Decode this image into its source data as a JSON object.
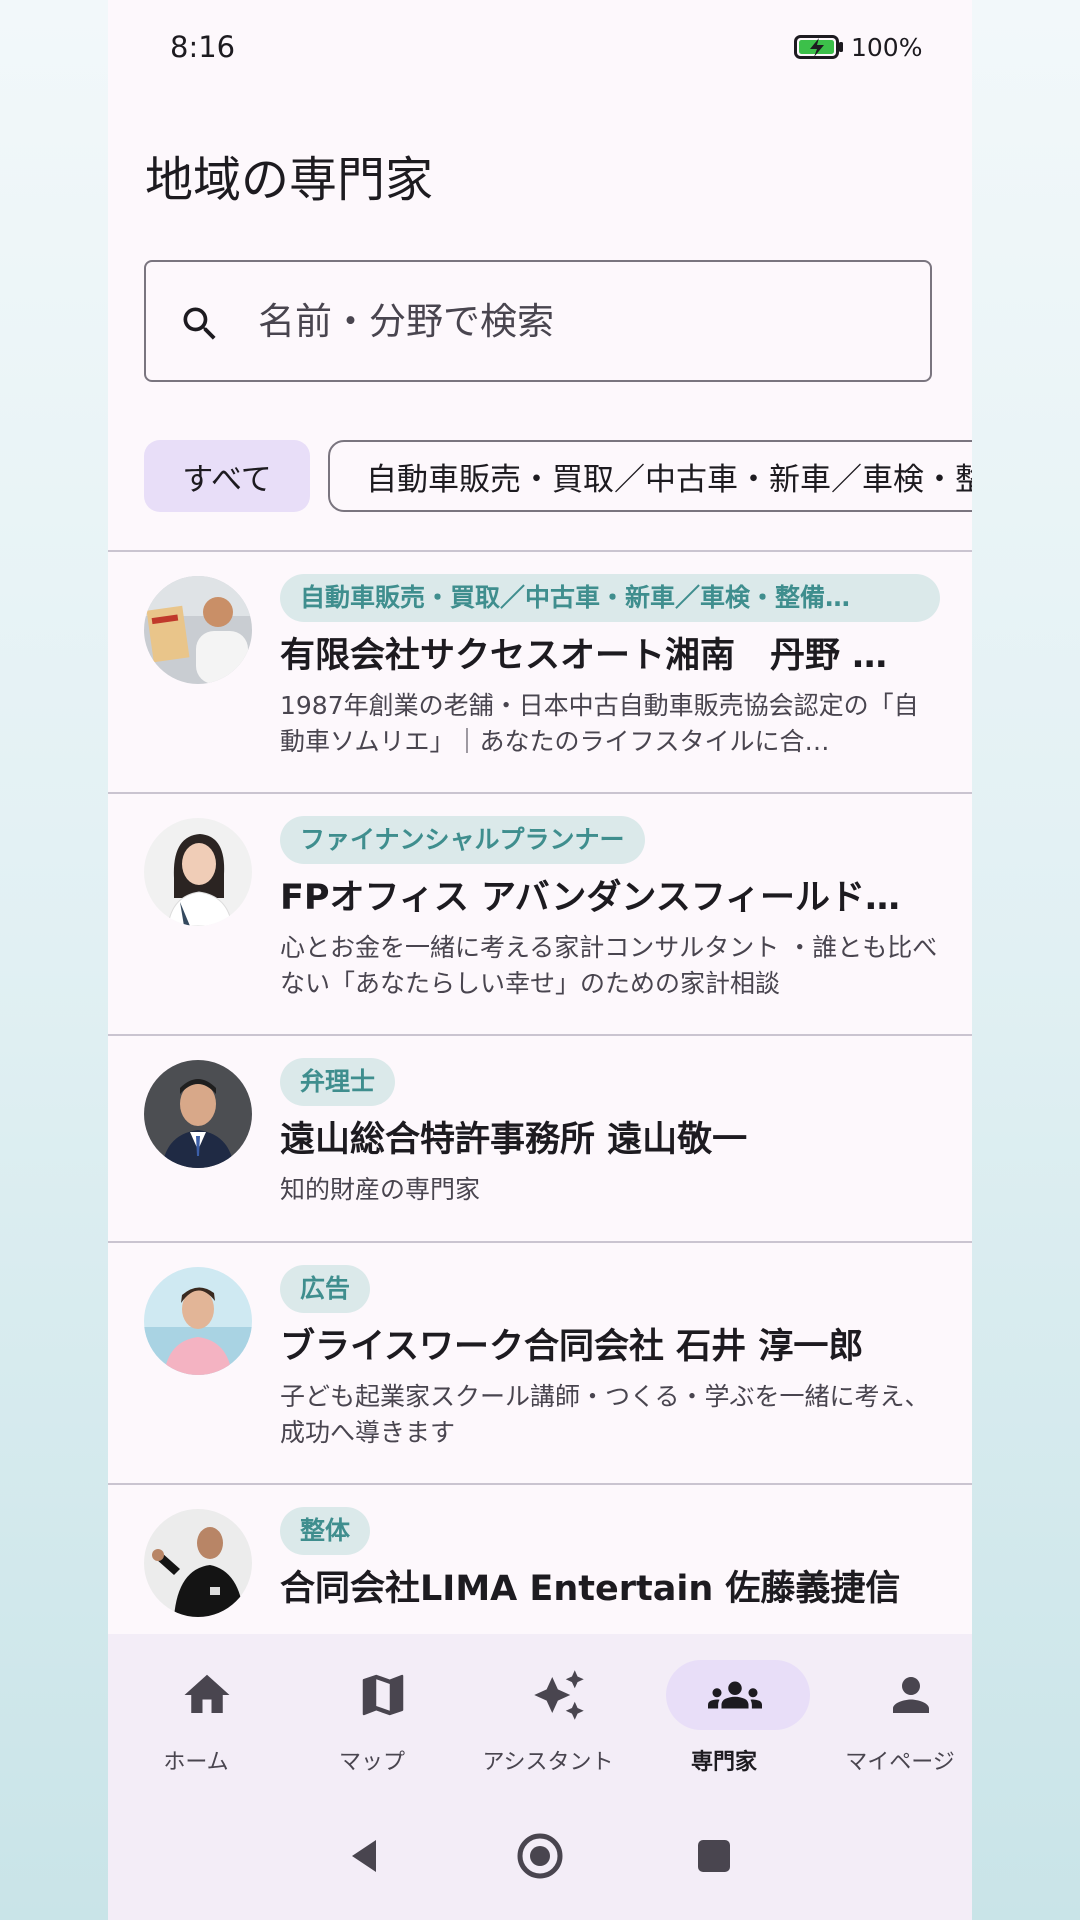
{
  "status_bar": {
    "time": "8:16",
    "battery": "100%"
  },
  "page_title": "地域の専門家",
  "search": {
    "placeholder": "名前・分野で検索",
    "value": ""
  },
  "chips": [
    {
      "label": "すべて",
      "selected": true
    },
    {
      "label": "自動車販売・買取／中古車・新車／車検・整備",
      "selected": false
    }
  ],
  "experts": [
    {
      "tag": "自動車販売・買取／中古車・新車／車検・整備…",
      "name": "有限会社サクセスオート湘南　丹野 …",
      "description": "1987年創業の老舗・日本中古自動車販売協会認定の「自動車ソムリエ」｜あなたのライフスタイルに合…"
    },
    {
      "tag": "ファイナンシャルプランナー",
      "name": "FPオフィス アバンダンスフィールド…",
      "description": "心とお金を一緒に考える家計コンサルタント ・誰とも比べない「あなたらしい幸せ」のための家計相談"
    },
    {
      "tag": "弁理士",
      "name": "遠山総合特許事務所 遠山敬一",
      "description": "知的財産の専門家"
    },
    {
      "tag": "広告",
      "name": "ブライスワーク合同会社 石井 淳一郎",
      "description": "子ども起業家スクール講師・つくる・学ぶを一緒に考え、成功へ導きます"
    },
    {
      "tag": "整体",
      "name": "合同会社LIMA Entertain 佐藤義捷信",
      "description": ""
    }
  ],
  "bottom_nav": [
    {
      "label": "ホーム",
      "icon": "home-icon",
      "active": false
    },
    {
      "label": "マップ",
      "icon": "map-icon",
      "active": false
    },
    {
      "label": "アシスタント",
      "icon": "sparkle-icon",
      "active": false
    },
    {
      "label": "専門家",
      "icon": "groups-icon",
      "active": true
    },
    {
      "label": "マイページ",
      "icon": "person-icon",
      "active": false
    }
  ],
  "colors": {
    "background": "#fdf8fc",
    "tag_bg": "#dbe9ea",
    "tag_text": "#3f8e8e",
    "chip_selected": "#e8def8",
    "nav_bg": "#f3edf7"
  }
}
